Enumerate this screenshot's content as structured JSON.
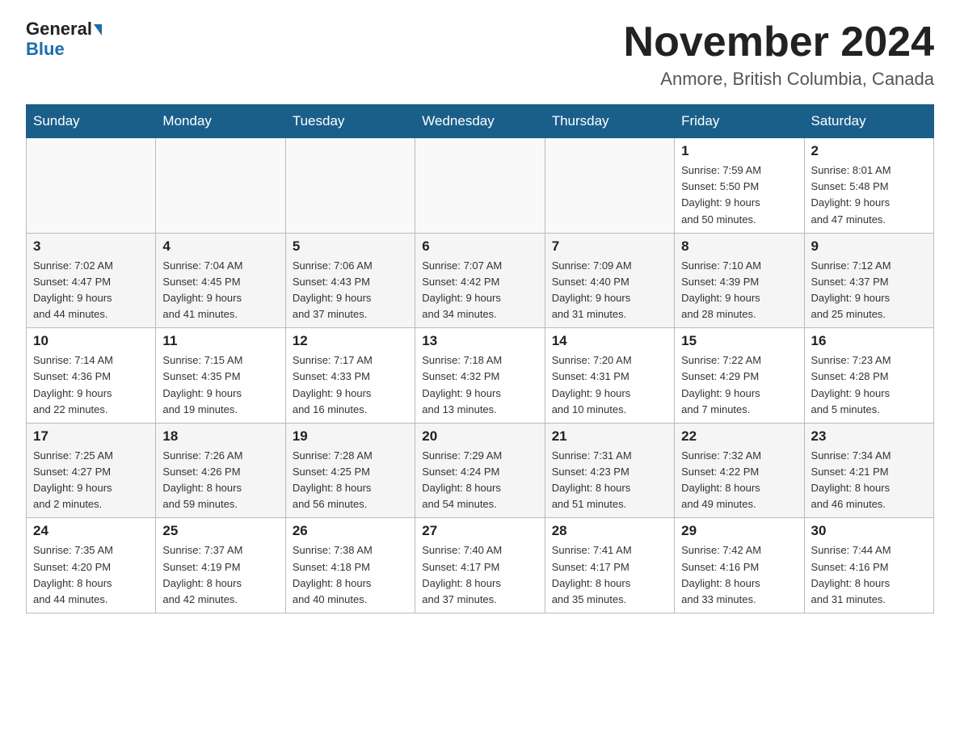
{
  "header": {
    "logo_general": "General",
    "logo_blue": "Blue",
    "main_title": "November 2024",
    "subtitle": "Anmore, British Columbia, Canada"
  },
  "days_of_week": [
    "Sunday",
    "Monday",
    "Tuesday",
    "Wednesday",
    "Thursday",
    "Friday",
    "Saturday"
  ],
  "weeks": [
    [
      {
        "day": "",
        "info": ""
      },
      {
        "day": "",
        "info": ""
      },
      {
        "day": "",
        "info": ""
      },
      {
        "day": "",
        "info": ""
      },
      {
        "day": "",
        "info": ""
      },
      {
        "day": "1",
        "info": "Sunrise: 7:59 AM\nSunset: 5:50 PM\nDaylight: 9 hours\nand 50 minutes."
      },
      {
        "day": "2",
        "info": "Sunrise: 8:01 AM\nSunset: 5:48 PM\nDaylight: 9 hours\nand 47 minutes."
      }
    ],
    [
      {
        "day": "3",
        "info": "Sunrise: 7:02 AM\nSunset: 4:47 PM\nDaylight: 9 hours\nand 44 minutes."
      },
      {
        "day": "4",
        "info": "Sunrise: 7:04 AM\nSunset: 4:45 PM\nDaylight: 9 hours\nand 41 minutes."
      },
      {
        "day": "5",
        "info": "Sunrise: 7:06 AM\nSunset: 4:43 PM\nDaylight: 9 hours\nand 37 minutes."
      },
      {
        "day": "6",
        "info": "Sunrise: 7:07 AM\nSunset: 4:42 PM\nDaylight: 9 hours\nand 34 minutes."
      },
      {
        "day": "7",
        "info": "Sunrise: 7:09 AM\nSunset: 4:40 PM\nDaylight: 9 hours\nand 31 minutes."
      },
      {
        "day": "8",
        "info": "Sunrise: 7:10 AM\nSunset: 4:39 PM\nDaylight: 9 hours\nand 28 minutes."
      },
      {
        "day": "9",
        "info": "Sunrise: 7:12 AM\nSunset: 4:37 PM\nDaylight: 9 hours\nand 25 minutes."
      }
    ],
    [
      {
        "day": "10",
        "info": "Sunrise: 7:14 AM\nSunset: 4:36 PM\nDaylight: 9 hours\nand 22 minutes."
      },
      {
        "day": "11",
        "info": "Sunrise: 7:15 AM\nSunset: 4:35 PM\nDaylight: 9 hours\nand 19 minutes."
      },
      {
        "day": "12",
        "info": "Sunrise: 7:17 AM\nSunset: 4:33 PM\nDaylight: 9 hours\nand 16 minutes."
      },
      {
        "day": "13",
        "info": "Sunrise: 7:18 AM\nSunset: 4:32 PM\nDaylight: 9 hours\nand 13 minutes."
      },
      {
        "day": "14",
        "info": "Sunrise: 7:20 AM\nSunset: 4:31 PM\nDaylight: 9 hours\nand 10 minutes."
      },
      {
        "day": "15",
        "info": "Sunrise: 7:22 AM\nSunset: 4:29 PM\nDaylight: 9 hours\nand 7 minutes."
      },
      {
        "day": "16",
        "info": "Sunrise: 7:23 AM\nSunset: 4:28 PM\nDaylight: 9 hours\nand 5 minutes."
      }
    ],
    [
      {
        "day": "17",
        "info": "Sunrise: 7:25 AM\nSunset: 4:27 PM\nDaylight: 9 hours\nand 2 minutes."
      },
      {
        "day": "18",
        "info": "Sunrise: 7:26 AM\nSunset: 4:26 PM\nDaylight: 8 hours\nand 59 minutes."
      },
      {
        "day": "19",
        "info": "Sunrise: 7:28 AM\nSunset: 4:25 PM\nDaylight: 8 hours\nand 56 minutes."
      },
      {
        "day": "20",
        "info": "Sunrise: 7:29 AM\nSunset: 4:24 PM\nDaylight: 8 hours\nand 54 minutes."
      },
      {
        "day": "21",
        "info": "Sunrise: 7:31 AM\nSunset: 4:23 PM\nDaylight: 8 hours\nand 51 minutes."
      },
      {
        "day": "22",
        "info": "Sunrise: 7:32 AM\nSunset: 4:22 PM\nDaylight: 8 hours\nand 49 minutes."
      },
      {
        "day": "23",
        "info": "Sunrise: 7:34 AM\nSunset: 4:21 PM\nDaylight: 8 hours\nand 46 minutes."
      }
    ],
    [
      {
        "day": "24",
        "info": "Sunrise: 7:35 AM\nSunset: 4:20 PM\nDaylight: 8 hours\nand 44 minutes."
      },
      {
        "day": "25",
        "info": "Sunrise: 7:37 AM\nSunset: 4:19 PM\nDaylight: 8 hours\nand 42 minutes."
      },
      {
        "day": "26",
        "info": "Sunrise: 7:38 AM\nSunset: 4:18 PM\nDaylight: 8 hours\nand 40 minutes."
      },
      {
        "day": "27",
        "info": "Sunrise: 7:40 AM\nSunset: 4:17 PM\nDaylight: 8 hours\nand 37 minutes."
      },
      {
        "day": "28",
        "info": "Sunrise: 7:41 AM\nSunset: 4:17 PM\nDaylight: 8 hours\nand 35 minutes."
      },
      {
        "day": "29",
        "info": "Sunrise: 7:42 AM\nSunset: 4:16 PM\nDaylight: 8 hours\nand 33 minutes."
      },
      {
        "day": "30",
        "info": "Sunrise: 7:44 AM\nSunset: 4:16 PM\nDaylight: 8 hours\nand 31 minutes."
      }
    ]
  ]
}
